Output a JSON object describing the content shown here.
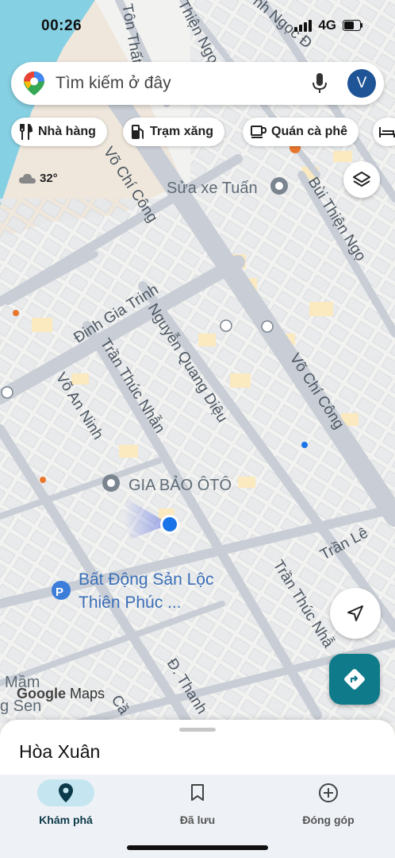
{
  "status": {
    "time": "00:26",
    "network": "4G"
  },
  "search": {
    "placeholder": "Tìm kiếm ở đây",
    "avatar_letter": "V"
  },
  "chips": [
    {
      "label": "Nhà hàng",
      "icon": "fork-knife-icon"
    },
    {
      "label": "Trạm xăng",
      "icon": "gas-station-icon"
    },
    {
      "label": "Quán cà phê",
      "icon": "coffee-cup-icon"
    }
  ],
  "weather": {
    "temp": "32°",
    "icon": "cloud-icon"
  },
  "map": {
    "streets": {
      "vo_chi_cong_1": "Võ Chí Công",
      "vo_chi_cong_2": "Võ Chí Công",
      "dinh_gia_trinh": "Đinh Gia Trinh",
      "nguyen_quang_dieu": "Nguyễn Quang Diệu",
      "tran_thuc_nhan_1": "Trần Thúc Nhẫn",
      "tran_thuc_nhan_2": "Trần Thúc Nhẫ",
      "vo_an_ninh": "Võ An Ninh",
      "bui_thien_ngo": "Bùi Thiện Ngọ",
      "tran_le": "Trần Lê",
      "d_thanh": "Đ. Thanh",
      "top_1": "Tôn Thất",
      "top_2": "Thiện Ngọ",
      "top_3": "nh Ngọc Đ",
      "cau": "Cầ"
    },
    "places": {
      "sua_xe": "Sửa xe Tuấn",
      "gia_bao": "GIA BẢO ÔTÔ",
      "bat_dong_san_1": "Bất Động Sản Lộc",
      "bat_dong_san_2": "Thiên Phúc ...",
      "mam_1": "Mầm",
      "mam_2": "g Sen"
    },
    "logo_google": "Google",
    "logo_maps": "Maps",
    "colors": {
      "road": "#c9ced6",
      "road_edge": "#b7bdc6",
      "block": "#e7e9ec",
      "land": "#f2f2f0",
      "water": "#86d0e3",
      "location": "#1a73e8"
    }
  },
  "sheet": {
    "title": "Hòa Xuân"
  },
  "nav": [
    {
      "label": "Khám phá",
      "icon": "explore-pin-icon",
      "active": true
    },
    {
      "label": "Đã lưu",
      "icon": "bookmark-icon",
      "active": false
    },
    {
      "label": "Đóng góp",
      "icon": "add-circle-icon",
      "active": false
    }
  ]
}
